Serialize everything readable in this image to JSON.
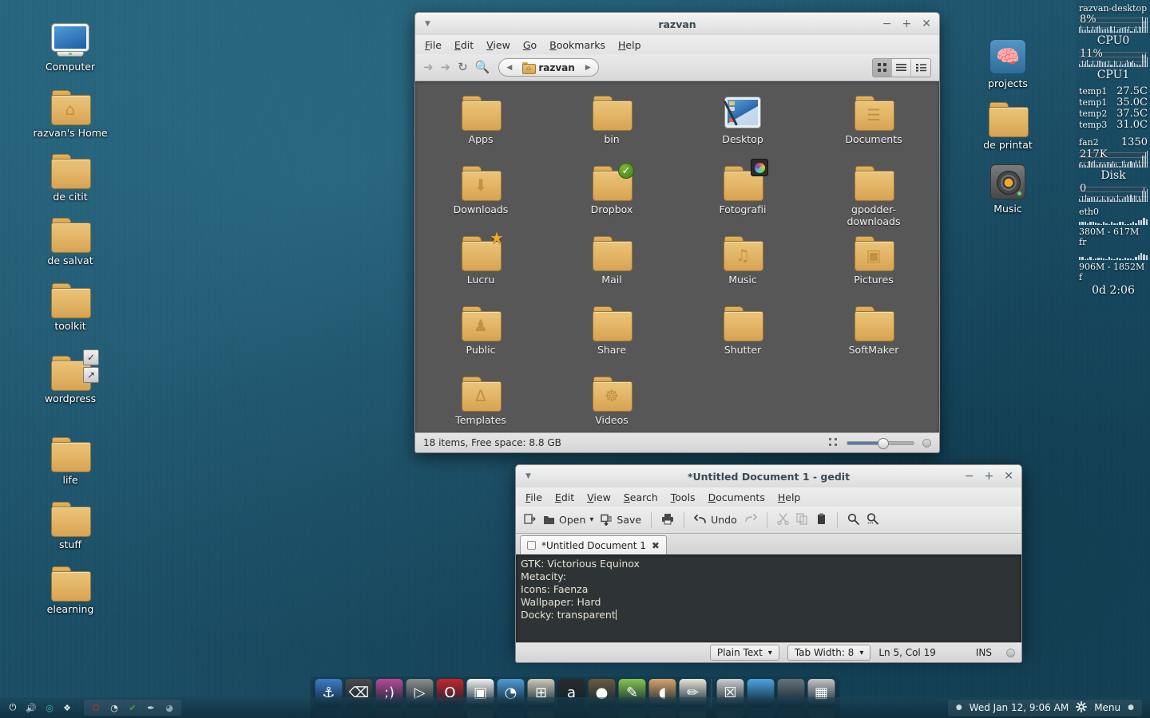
{
  "desktop": {
    "left_icons": [
      {
        "label": "Computer",
        "icon": "computer-icon",
        "emblem": null
      },
      {
        "label": "razvan's Home",
        "icon": "folder-home-icon",
        "emblem": null
      },
      {
        "label": "de citit",
        "icon": "folder-icon",
        "emblem": null
      },
      {
        "label": "de salvat",
        "icon": "folder-icon",
        "emblem": null
      },
      {
        "label": "toolkit",
        "icon": "folder-icon",
        "emblem": null
      },
      {
        "label": "wordpress",
        "icon": "folder-icon",
        "emblem": "check-and-link"
      },
      {
        "label": "life",
        "icon": "folder-icon",
        "emblem": null
      },
      {
        "label": "stuff",
        "icon": "folder-icon",
        "emblem": null
      },
      {
        "label": "elearning",
        "icon": "folder-icon",
        "emblem": null
      }
    ],
    "right_icons": [
      {
        "label": "projects",
        "icon": "brain-app-icon",
        "emblem": null
      },
      {
        "label": "de printat",
        "icon": "folder-icon",
        "emblem": null
      },
      {
        "label": "Music",
        "icon": "speaker-app-icon",
        "emblem": "link"
      }
    ]
  },
  "filemanager": {
    "title": "razvan",
    "menu": [
      "File",
      "Edit",
      "View",
      "Go",
      "Bookmarks",
      "Help"
    ],
    "toolbar": {
      "back_icon": "back-arrow-icon",
      "forward_icon": "forward-arrow-icon",
      "reload_icon": "reload-icon",
      "search_icon": "search-icon",
      "path_prev_icon": "path-left-arrow-icon",
      "path_next_icon": "path-right-arrow-icon",
      "crumb_label": "razvan",
      "view_icon_grid": "grid-view-icon",
      "view_icon_list": "list-view-icon",
      "view_icon_compact": "compact-view-icon"
    },
    "window_buttons": {
      "minimize": "−",
      "maximize": "+",
      "close": "✕"
    },
    "items": [
      {
        "name": "Apps",
        "icon": "folder-icon",
        "inner": "",
        "emblem": null
      },
      {
        "name": "bin",
        "icon": "folder-icon",
        "inner": "",
        "emblem": null
      },
      {
        "name": "Desktop",
        "icon": "desktop-icon",
        "inner": "",
        "emblem": null
      },
      {
        "name": "Documents",
        "icon": "folder-documents-icon",
        "inner": "☰",
        "emblem": null
      },
      {
        "name": "Downloads",
        "icon": "folder-downloads-icon",
        "inner": "⬇",
        "emblem": null
      },
      {
        "name": "Dropbox",
        "icon": "folder-icon",
        "inner": "",
        "emblem": "check"
      },
      {
        "name": "Fotografii",
        "icon": "folder-icon",
        "inner": "",
        "emblem": "color-wheel"
      },
      {
        "name": "gpodder-downloads",
        "icon": "folder-icon",
        "inner": "",
        "emblem": null
      },
      {
        "name": "Lucru",
        "icon": "folder-icon",
        "inner": "",
        "emblem": "star"
      },
      {
        "name": "Mail",
        "icon": "folder-icon",
        "inner": "",
        "emblem": null
      },
      {
        "name": "Music",
        "icon": "folder-music-icon",
        "inner": "♫",
        "emblem": null
      },
      {
        "name": "Pictures",
        "icon": "folder-pictures-icon",
        "inner": "▣",
        "emblem": null
      },
      {
        "name": "Public",
        "icon": "folder-public-icon",
        "inner": "♟",
        "emblem": null
      },
      {
        "name": "Share",
        "icon": "folder-icon",
        "inner": "",
        "emblem": null
      },
      {
        "name": "Shutter",
        "icon": "folder-icon",
        "inner": "",
        "emblem": null
      },
      {
        "name": "SoftMaker",
        "icon": "folder-icon",
        "inner": "",
        "emblem": null
      },
      {
        "name": "Templates",
        "icon": "folder-templates-icon",
        "inner": "∆",
        "emblem": null
      },
      {
        "name": "Videos",
        "icon": "folder-videos-icon",
        "inner": "☸",
        "emblem": null
      }
    ],
    "status": "18 items, Free space: 8.8 GB",
    "zoom_level": 52
  },
  "gedit": {
    "title": "*Untitled Document 1 - gedit",
    "menu": [
      "File",
      "Edit",
      "View",
      "Search",
      "Tools",
      "Documents",
      "Help"
    ],
    "toolbar": {
      "new_icon": "new-document-icon",
      "open_label": "Open",
      "open_icon": "open-folder-icon",
      "open_dropdown": "▾",
      "save_label": "Save",
      "save_icon": "save-icon",
      "print_icon": "print-icon",
      "undo_label": "Undo",
      "undo_icon": "undo-arrow-icon",
      "redo_icon": "redo-arrow-icon",
      "cut_icon": "scissors-icon",
      "copy_icon": "copy-icon",
      "paste_icon": "clipboard-icon",
      "find_icon": "search-icon",
      "replace_icon": "search-replace-icon"
    },
    "tab_label": "*Untitled Document 1",
    "tab_close": "✖",
    "document_lines": [
      "GTK: Victorious Equinox",
      "Metacity:",
      "Icons: Faenza",
      "Wallpaper: Hard",
      "Docky: transparent"
    ],
    "statusbar": {
      "language": "Plain Text",
      "language_caret": "▾",
      "tab_width": "Tab Width: 8",
      "tab_caret": "▾",
      "position": "Ln 5, Col 19",
      "insert_mode": "INS"
    },
    "window_buttons": {
      "minimize": "−",
      "maximize": "+",
      "close": "✕"
    }
  },
  "conky": {
    "hostname": "razvan-desktop",
    "cpu0": {
      "label": "CPU0",
      "value": "8%"
    },
    "cpu1": {
      "label": "CPU1",
      "value": "11%"
    },
    "temps": [
      {
        "label": "temp1",
        "value": "27.5C"
      },
      {
        "label": "temp1",
        "value": "35.0C"
      },
      {
        "label": "temp2",
        "value": "37.5C"
      },
      {
        "label": "temp3",
        "value": "31.0C"
      }
    ],
    "fan": {
      "label": "fan2",
      "value": "1350"
    },
    "mem_value": "217K",
    "disk_label": "Disk",
    "disk_value": "0",
    "net_label": "eth0",
    "net_down": "380M - 617M fr",
    "net_up": "906M - 1852M f",
    "uptime": "0d  2:06"
  },
  "dock": {
    "items": [
      {
        "name": "docky-anchor",
        "glyph": "⚓",
        "color": "#3d7cc9"
      },
      {
        "name": "terminal",
        "glyph": "⌫",
        "color": "#4a4a4a"
      },
      {
        "name": "pidgin-messenger",
        "glyph": ";)",
        "color": "#b84a96"
      },
      {
        "name": "media-player",
        "glyph": "▷",
        "color": "#8d8d8d"
      },
      {
        "name": "opera-browser",
        "glyph": "O",
        "color": "#c8252a"
      },
      {
        "name": "tv-player",
        "glyph": "▣",
        "color": "#f2f2f2"
      },
      {
        "name": "shotwell-photos",
        "glyph": "◔",
        "color": "#4f9bd6"
      },
      {
        "name": "calculator",
        "glyph": "⊞",
        "color": "#cfc9b8"
      },
      {
        "name": "amazon-store",
        "glyph": "a",
        "color": "#2b2b2b"
      },
      {
        "name": "gimp-editor",
        "glyph": "●",
        "color": "#6d5840"
      },
      {
        "name": "tomboy-notes",
        "glyph": "✎",
        "color": "#86c450"
      },
      {
        "name": "nautilus-files",
        "glyph": "◖",
        "color": "#d9a36b"
      },
      {
        "name": "gedit-editor",
        "glyph": "✏",
        "color": "#e8e4d8"
      },
      {
        "name": "trash",
        "glyph": "☒",
        "color": "#cfcfcf"
      },
      {
        "name": "workspace-one",
        "glyph": "",
        "color": "#4fa3e3"
      },
      {
        "name": "workspace-two",
        "glyph": "",
        "color": "#68727a"
      },
      {
        "name": "image-thumb",
        "glyph": "▦",
        "color": "#c4c4c4"
      }
    ]
  },
  "panel": {
    "power_icon": "power-icon",
    "volume_icon": "volume-icon",
    "tray_left": [
      {
        "name": "indicator-sync-icon",
        "glyph": "◎",
        "color": "#3fb7a8"
      },
      {
        "name": "dropbox-tray-icon",
        "glyph": "❖",
        "color": "#e9eef1"
      }
    ],
    "tray_items": [
      {
        "name": "opera-tray-icon",
        "glyph": "O",
        "color": "#c8252a"
      },
      {
        "name": "radio-tray-icon",
        "glyph": "◔",
        "color": "#e8e8e8"
      },
      {
        "name": "shield-tray-icon",
        "glyph": "✔",
        "color": "#4f9c2d"
      },
      {
        "name": "brush-tray-icon",
        "glyph": "✒",
        "color": "#dcdcdc"
      },
      {
        "name": "shotwell-tray-icon",
        "glyph": "◕",
        "color": "#8fa6b2"
      }
    ],
    "clock": "Wed Jan 12, 9:06 AM",
    "settings_icon": "gear-icon",
    "menu_label": "Menu",
    "left_bullet": "●",
    "right_bullet": "●"
  }
}
